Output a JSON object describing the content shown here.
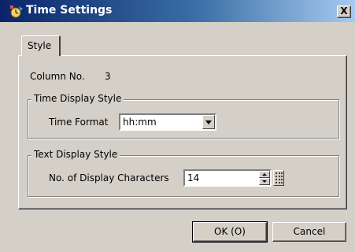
{
  "window": {
    "title": "Time Settings",
    "close_glyph": "X",
    "icon": "clock-settings-icon"
  },
  "tabs": [
    {
      "label": "Style",
      "selected": true
    }
  ],
  "column": {
    "label": "Column No.",
    "value": "3"
  },
  "time_display": {
    "legend": "Time Display Style",
    "format_label": "Time Format",
    "format_value": "hh:mm"
  },
  "text_display": {
    "legend": "Text Display Style",
    "chars_label": "No. of Display Characters",
    "chars_value": "14"
  },
  "buttons": {
    "ok": "OK (O)",
    "cancel": "Cancel"
  },
  "colors": {
    "dialog_face": "#d4d0c8",
    "title_start": "#0a246a",
    "title_end": "#a6caf0"
  }
}
